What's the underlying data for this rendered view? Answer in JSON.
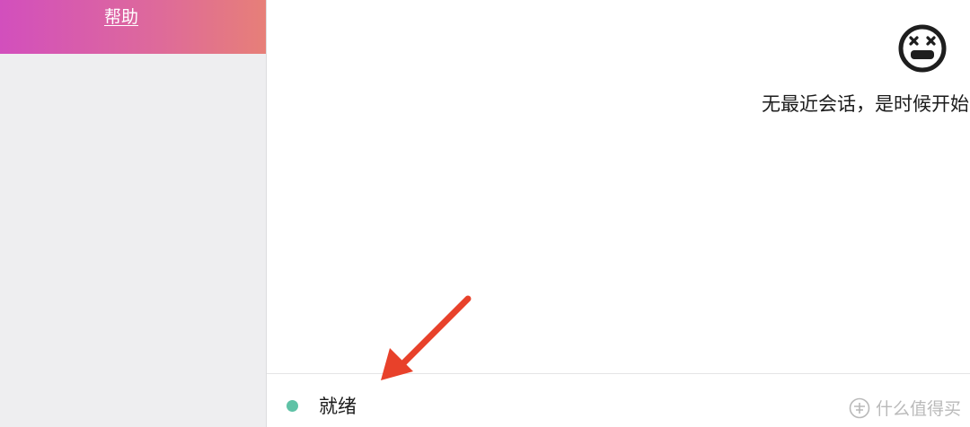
{
  "sidebar": {
    "help_label": "帮助",
    "banner_colors": [
      "#d24fbd",
      "#e77f78"
    ]
  },
  "main": {
    "empty_icon": "dizzy-face-icon",
    "empty_message": "无最近会话，是时候开始"
  },
  "status": {
    "text": "就绪",
    "dot_color": "#5fc2a6"
  },
  "annotation": {
    "arrow_color": "#e8412a"
  },
  "watermark": {
    "icon": "zhi-logo-icon",
    "text": "什么值得买"
  }
}
